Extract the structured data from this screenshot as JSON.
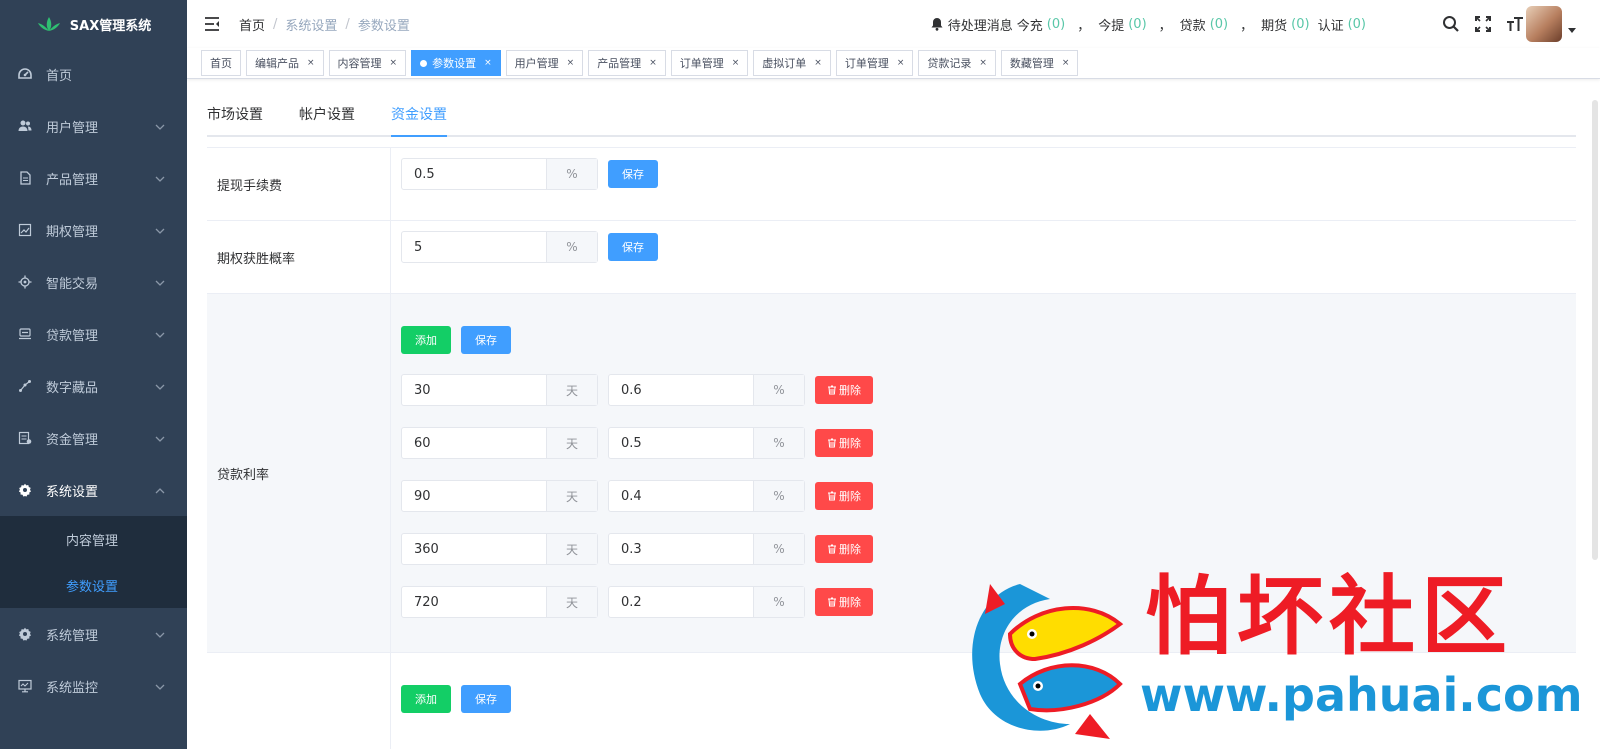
{
  "app": {
    "title": "SAX管理系统"
  },
  "sidebar": {
    "items": [
      {
        "label": "首页",
        "icon": "dashboard-icon"
      },
      {
        "label": "用户管理",
        "icon": "users-icon"
      },
      {
        "label": "产品管理",
        "icon": "document-icon"
      },
      {
        "label": "期权管理",
        "icon": "chart-icon"
      },
      {
        "label": "智能交易",
        "icon": "gear-small-icon"
      },
      {
        "label": "贷款管理",
        "icon": "loan-icon"
      },
      {
        "label": "数字藏品",
        "icon": "nodes-icon"
      },
      {
        "label": "资金管理",
        "icon": "money-icon"
      },
      {
        "label": "系统设置",
        "icon": "gear-icon"
      },
      {
        "label": "系统管理",
        "icon": "gear-icon"
      },
      {
        "label": "系统监控",
        "icon": "monitor-icon"
      }
    ],
    "submenu": [
      {
        "label": "内容管理"
      },
      {
        "label": "参数设置"
      }
    ]
  },
  "header": {
    "breadcrumb": [
      "首页",
      "系统设置",
      "参数设置"
    ],
    "notice_label": "待处理消息",
    "notices": [
      {
        "label": "今充",
        "count": "(0)"
      },
      {
        "label": "今提",
        "count": "(0)"
      },
      {
        "label": "贷款",
        "count": "(0)"
      },
      {
        "label": "期货",
        "count": "(0)"
      },
      {
        "label": "认证",
        "count": "(0)"
      }
    ],
    "separator": "，"
  },
  "tags": [
    {
      "label": "首页"
    },
    {
      "label": "编辑产品"
    },
    {
      "label": "内容管理"
    },
    {
      "label": "参数设置"
    },
    {
      "label": "用户管理"
    },
    {
      "label": "产品管理"
    },
    {
      "label": "订单管理"
    },
    {
      "label": "虚拟订单"
    },
    {
      "label": "订单管理"
    },
    {
      "label": "贷款记录"
    },
    {
      "label": "数藏管理"
    }
  ],
  "tag_close": "×",
  "subtabs": [
    "市场设置",
    "帐户设置",
    "资金设置"
  ],
  "form": {
    "withdraw": {
      "label": "提现手续费",
      "value": "0.5",
      "suffix": "%",
      "save": "保存"
    },
    "option_win": {
      "label": "期权获胜概率",
      "value": "5",
      "suffix": "%",
      "save": "保存"
    },
    "loan_rate": {
      "label": "贷款利率",
      "add": "添加",
      "save": "保存",
      "day_suffix": "天",
      "pct_suffix": "%",
      "delete": "删除",
      "rows": [
        {
          "days": "30",
          "rate": "0.6"
        },
        {
          "days": "60",
          "rate": "0.5"
        },
        {
          "days": "90",
          "rate": "0.4"
        },
        {
          "days": "360",
          "rate": "0.3"
        },
        {
          "days": "720",
          "rate": "0.2"
        }
      ]
    },
    "next_section": {
      "add": "添加",
      "save": "保存"
    }
  },
  "watermark": {
    "title": "怕坏社区",
    "url": "www.pahuai.com"
  },
  "colors": {
    "primary": "#409eff",
    "success": "#13ce66",
    "danger": "#ff4949",
    "sidebar": "#304156"
  }
}
